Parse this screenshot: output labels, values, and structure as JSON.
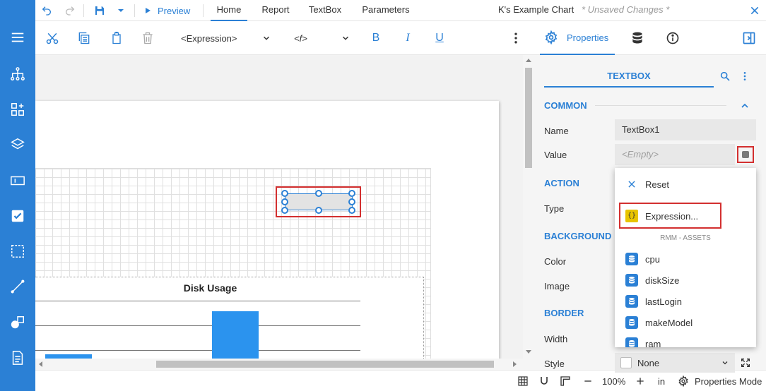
{
  "colors": {
    "accent": "#2b80d5",
    "sidebar": "#2b80d5",
    "highlight": "#d32f2f",
    "bar": "#2b93ee"
  },
  "header": {
    "preview_label": "Preview",
    "tabs": [
      "Home",
      "Report",
      "TextBox",
      "Parameters"
    ],
    "active_tab": "Home",
    "doc_title": "K's Example Chart",
    "unsaved": "* Unsaved Changes *"
  },
  "toolbar": {
    "expression_dropdown": "<Expression>",
    "function_dropdown": "<f>",
    "bold": "B",
    "italic": "I",
    "underline": "U"
  },
  "panel_tabs": {
    "properties": "Properties"
  },
  "canvas": {
    "chart_title": "Disk Usage"
  },
  "status": {
    "zoom": "100%",
    "units": "in",
    "mode": "Properties Mode"
  },
  "props": {
    "header": "TEXTBOX",
    "sections": {
      "common": "COMMON",
      "action": "ACTION",
      "background": "BACKGROUND",
      "border": "BORDER"
    },
    "labels": {
      "name": "Name",
      "value": "Value",
      "type": "Type",
      "color": "Color",
      "image": "Image",
      "width": "Width",
      "style": "Style"
    },
    "name_value": "TextBox1",
    "value_placeholder": "<Empty>",
    "style_value": "None"
  },
  "popup": {
    "reset": "Reset",
    "expression": "Expression...",
    "heading": "RMM - ASSETS",
    "fields": [
      "cpu",
      "diskSize",
      "lastLogin",
      "makeModel",
      "ram"
    ]
  }
}
